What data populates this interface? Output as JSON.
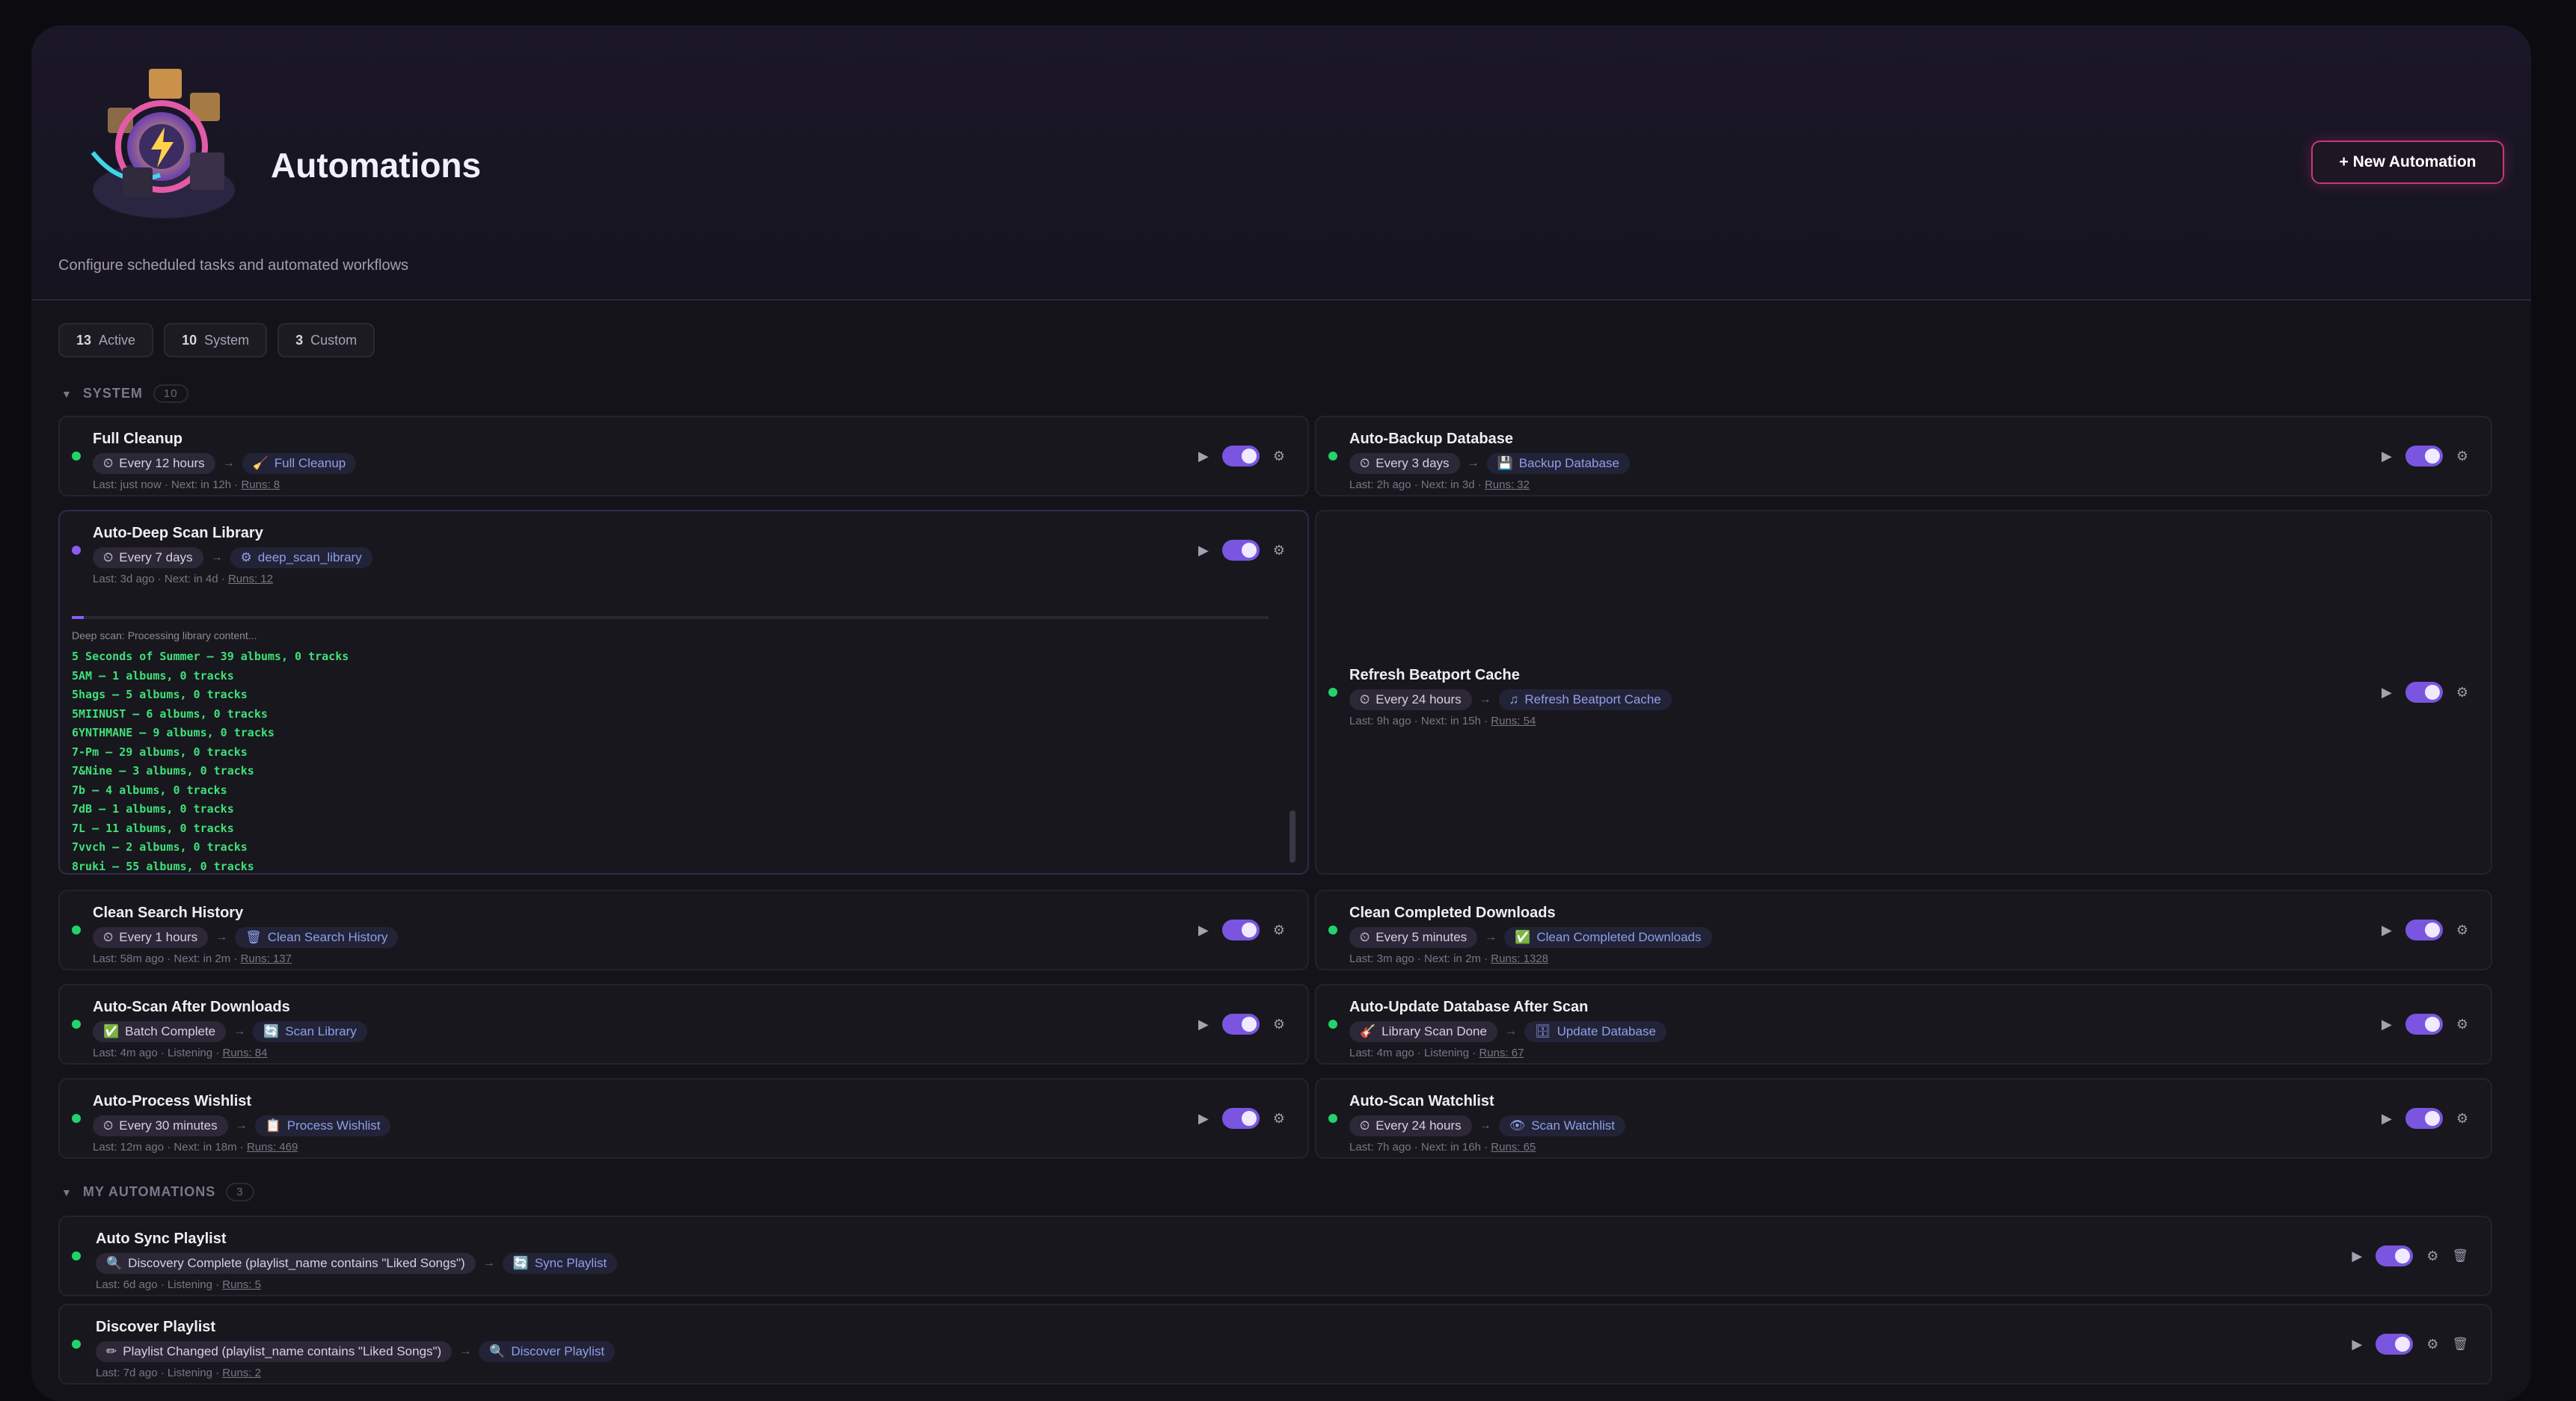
{
  "header": {
    "title": "Automations",
    "subtitle": "Configure scheduled tasks and automated workflows",
    "new_button": "+ New Automation"
  },
  "stats": [
    {
      "count": "13",
      "label": "Active"
    },
    {
      "count": "10",
      "label": "System"
    },
    {
      "count": "3",
      "label": "Custom"
    }
  ],
  "sections": {
    "system": {
      "label": "SYSTEM",
      "count": "10"
    },
    "custom": {
      "label": "MY AUTOMATIONS",
      "count": "3"
    }
  },
  "cards": {
    "full_cleanup": {
      "name": "Full Cleanup",
      "trigger": "Every 12 hours",
      "action": "Full Cleanup",
      "meta": "Last: just now · Next: in 12h ·",
      "runs": "Runs: 8"
    },
    "auto_backup": {
      "name": "Auto-Backup Database",
      "trigger": "Every 3 days",
      "action": "Backup Database",
      "meta": "Last: 2h ago · Next: in 3d ·",
      "runs": "Runs: 32"
    },
    "deep_scan": {
      "name": "Auto-Deep Scan Library",
      "trigger": "Every 7 days",
      "action": "deep_scan_library",
      "meta": "Last: 3d ago · Next: in 4d ·",
      "runs": "Runs: 12",
      "log_status": "Deep scan: Processing library content...",
      "log_lines": [
        "5 Seconds of Summer — 39 albums, 0 tracks",
        "5AM — 1 albums, 0 tracks",
        "5hags — 5 albums, 0 tracks",
        "5MIINUST — 6 albums, 0 tracks",
        "6YNTHMANE — 9 albums, 0 tracks",
        "7-Pm — 29 albums, 0 tracks",
        "7&Nine — 3 albums, 0 tracks",
        "7b — 4 albums, 0 tracks",
        "7dB — 1 albums, 0 tracks",
        "7L — 11 albums, 0 tracks",
        "7vvch — 2 albums, 0 tracks",
        "8ruki — 55 albums, 0 tracks"
      ]
    },
    "beatport": {
      "name": "Refresh Beatport Cache",
      "trigger": "Every 24 hours",
      "action": "Refresh Beatport Cache",
      "meta": "Last: 9h ago · Next: in 15h ·",
      "runs": "Runs: 54"
    },
    "clean_search": {
      "name": "Clean Search History",
      "trigger": "Every 1 hours",
      "action": "Clean Search History",
      "meta": "Last: 58m ago · Next: in 2m ·",
      "runs": "Runs: 137"
    },
    "clean_downloads": {
      "name": "Clean Completed Downloads",
      "trigger": "Every 5 minutes",
      "action": "Clean Completed Downloads",
      "meta": "Last: 3m ago · Next: in 2m ·",
      "runs": "Runs: 1328"
    },
    "scan_after_downloads": {
      "name": "Auto-Scan After Downloads",
      "trigger": "Batch Complete",
      "action": "Scan Library",
      "meta": "Last: 4m ago · Listening ·",
      "runs": "Runs: 84"
    },
    "update_db": {
      "name": "Auto-Update Database After Scan",
      "trigger": "Library Scan Done",
      "action": "Update Database",
      "meta": "Last: 4m ago · Listening ·",
      "runs": "Runs: 67"
    },
    "wishlist": {
      "name": "Auto-Process Wishlist",
      "trigger": "Every 30 minutes",
      "action": "Process Wishlist",
      "meta": "Last: 12m ago · Next: in 18m ·",
      "runs": "Runs: 469"
    },
    "watchlist": {
      "name": "Auto-Scan Watchlist",
      "trigger": "Every 24 hours",
      "action": "Scan Watchlist",
      "meta": "Last: 7h ago · Next: in 16h ·",
      "runs": "Runs: 65"
    },
    "sync_playlist": {
      "name": "Auto Sync Playlist",
      "trigger": "Discovery Complete (playlist_name contains \"Liked Songs\")",
      "action": "Sync Playlist",
      "meta": "Last: 6d ago · Listening ·",
      "runs": "Runs: 5"
    },
    "discover_playlist": {
      "name": "Discover Playlist",
      "trigger": "Playlist Changed (playlist_name contains \"Liked Songs\")",
      "action": "Discover Playlist",
      "meta": "Last: 7d ago · Listening ·",
      "runs": "Runs: 2"
    }
  },
  "colors": {
    "accent": "#7a55e0",
    "active_dot": "#23d36a",
    "log_text": "#3fe07a",
    "button_border": "#c23a78"
  }
}
